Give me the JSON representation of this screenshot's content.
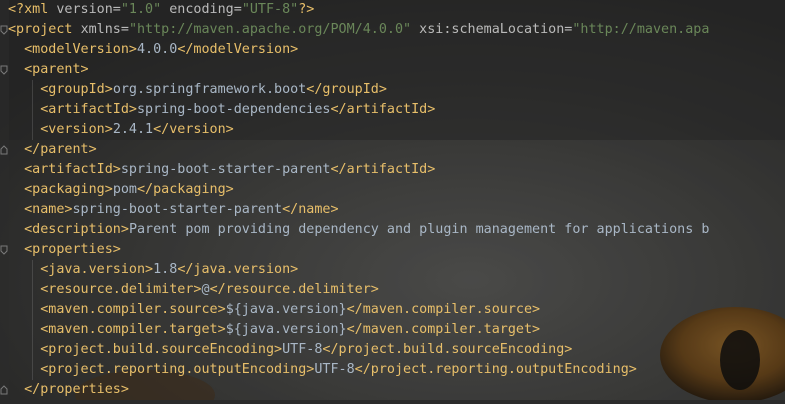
{
  "editor": {
    "lines": [
      {
        "indent": 0,
        "parts": [
          {
            "c": "pi",
            "t": "<?"
          },
          {
            "c": "tag",
            "t": "xml "
          },
          {
            "c": "attr",
            "t": "version="
          },
          {
            "c": "val",
            "t": "\"1.0\""
          },
          {
            "c": "attr",
            "t": " encoding="
          },
          {
            "c": "val",
            "t": "\"UTF-8\""
          },
          {
            "c": "pi",
            "t": "?>"
          }
        ]
      },
      {
        "indent": 0,
        "parts": [
          {
            "c": "tag",
            "t": "<project "
          },
          {
            "c": "attr",
            "t": "xmlns="
          },
          {
            "c": "val",
            "t": "\"http://maven.apache.org/POM/4.0.0\""
          },
          {
            "c": "attr",
            "t": " xsi:schemaLocation="
          },
          {
            "c": "val",
            "t": "\"http://maven.apa"
          }
        ]
      },
      {
        "indent": 1,
        "parts": [
          {
            "c": "tag",
            "t": "<modelVersion>"
          },
          {
            "c": "txt",
            "t": "4.0.0"
          },
          {
            "c": "tag",
            "t": "</modelVersion>"
          }
        ]
      },
      {
        "indent": 1,
        "parts": [
          {
            "c": "tag",
            "t": "<parent>"
          }
        ]
      },
      {
        "indent": 2,
        "parts": [
          {
            "c": "tag",
            "t": "<groupId>"
          },
          {
            "c": "txt",
            "t": "org.springframework.boot"
          },
          {
            "c": "tag",
            "t": "</groupId>"
          }
        ]
      },
      {
        "indent": 2,
        "parts": [
          {
            "c": "tag",
            "t": "<artifactId>"
          },
          {
            "c": "txt",
            "t": "spring-boot-dependencies"
          },
          {
            "c": "tag",
            "t": "</artifactId>"
          }
        ]
      },
      {
        "indent": 2,
        "parts": [
          {
            "c": "tag",
            "t": "<version>"
          },
          {
            "c": "txt",
            "t": "2.4.1"
          },
          {
            "c": "tag",
            "t": "</version>"
          }
        ]
      },
      {
        "indent": 1,
        "parts": [
          {
            "c": "tag",
            "t": "</parent>"
          }
        ]
      },
      {
        "indent": 1,
        "parts": [
          {
            "c": "tag",
            "t": "<artifactId>"
          },
          {
            "c": "txt",
            "t": "spring-boot-starter-parent"
          },
          {
            "c": "tag",
            "t": "</artifactId>"
          }
        ]
      },
      {
        "indent": 1,
        "parts": [
          {
            "c": "tag",
            "t": "<packaging>"
          },
          {
            "c": "txt",
            "t": "pom"
          },
          {
            "c": "tag",
            "t": "</packaging>"
          }
        ]
      },
      {
        "indent": 1,
        "parts": [
          {
            "c": "tag",
            "t": "<name>"
          },
          {
            "c": "txt",
            "t": "spring-boot-starter-parent"
          },
          {
            "c": "tag",
            "t": "</name>"
          }
        ]
      },
      {
        "indent": 1,
        "parts": [
          {
            "c": "tag",
            "t": "<description>"
          },
          {
            "c": "txt",
            "t": "Parent pom providing dependency and plugin management for applications b"
          }
        ]
      },
      {
        "indent": 1,
        "parts": [
          {
            "c": "tag",
            "t": "<properties>"
          }
        ]
      },
      {
        "indent": 2,
        "parts": [
          {
            "c": "tag",
            "t": "<java.version>"
          },
          {
            "c": "txt",
            "t": "1.8"
          },
          {
            "c": "tag",
            "t": "</java.version>"
          }
        ]
      },
      {
        "indent": 2,
        "parts": [
          {
            "c": "tag",
            "t": "<resource.delimiter>"
          },
          {
            "c": "txt",
            "t": "@"
          },
          {
            "c": "tag",
            "t": "</resource.delimiter>"
          }
        ]
      },
      {
        "indent": 2,
        "parts": [
          {
            "c": "tag",
            "t": "<maven.compiler.source>"
          },
          {
            "c": "txt",
            "t": "${java.version}"
          },
          {
            "c": "tag",
            "t": "</maven.compiler.source>"
          }
        ]
      },
      {
        "indent": 2,
        "parts": [
          {
            "c": "tag",
            "t": "<maven.compiler.target>"
          },
          {
            "c": "txt",
            "t": "${java.version}"
          },
          {
            "c": "tag",
            "t": "</maven.compiler.target>"
          }
        ]
      },
      {
        "indent": 2,
        "parts": [
          {
            "c": "tag",
            "t": "<project.build.sourceEncoding>"
          },
          {
            "c": "txt",
            "t": "UTF-8"
          },
          {
            "c": "tag",
            "t": "</project.build.sourceEncoding>"
          }
        ]
      },
      {
        "indent": 2,
        "parts": [
          {
            "c": "tag",
            "t": "<project.reporting.outputEncoding>"
          },
          {
            "c": "txt",
            "t": "UTF-8"
          },
          {
            "c": "tag",
            "t": "</project.reporting.outputEncoding>"
          }
        ]
      },
      {
        "indent": 1,
        "parts": [
          {
            "c": "tag",
            "t": "</properties>"
          }
        ]
      }
    ],
    "fold_lines": [
      1,
      3,
      7,
      12,
      19
    ],
    "colors": {
      "background": "#2b2b2b",
      "tag": "#e8bf6a",
      "attribute": "#bababa",
      "string": "#6a8759",
      "text": "#a9b7c6"
    },
    "background_image": "cat-face-photo"
  }
}
